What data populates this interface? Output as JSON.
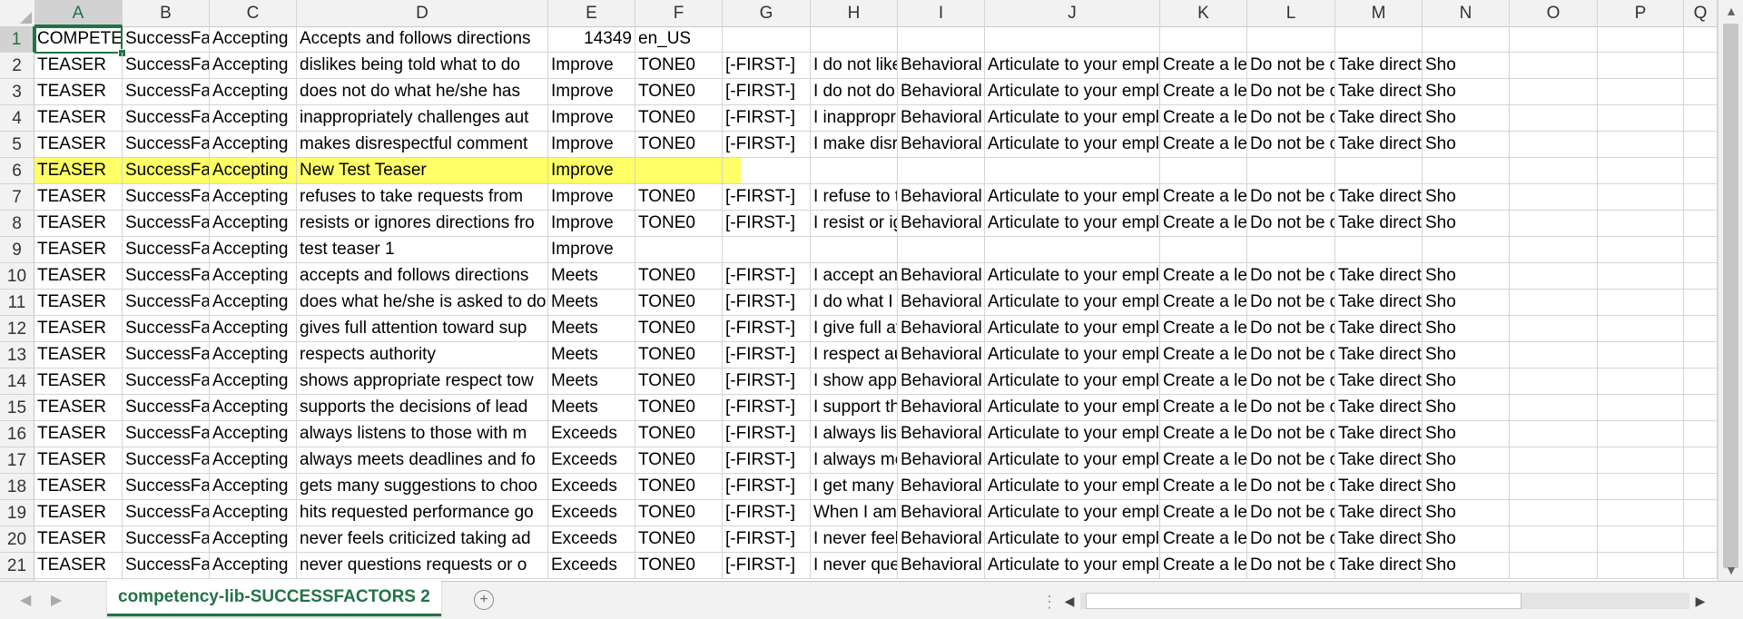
{
  "columns": [
    "A",
    "B",
    "C",
    "D",
    "E",
    "F",
    "G",
    "H",
    "I",
    "J",
    "K",
    "L",
    "M",
    "N",
    "O",
    "P",
    "Q"
  ],
  "selected_column": "A",
  "rows": [
    {
      "num": "1",
      "cells": [
        "COMPETENCY",
        "SuccessFactors",
        "Accepting",
        "Accepts and follows directions",
        "14349",
        "en_US",
        "",
        "",
        "",
        "",
        "",
        "",
        "",
        "",
        "",
        "",
        ""
      ]
    },
    {
      "num": "2",
      "cells": [
        "TEASER",
        "SuccessFactors",
        "Accepting",
        "dislikes being told what to do",
        "Improve",
        "TONE0",
        "[-FIRST-]",
        "I do not like",
        "Behavioral",
        "Articulate to your employee",
        "Create a level of mutual",
        "Do not be offended",
        "Take directions as opportunities",
        "Sho",
        "",
        "",
        ""
      ]
    },
    {
      "num": "3",
      "cells": [
        "TEASER",
        "SuccessFactors",
        "Accepting",
        "does not do what he/she has",
        "Improve",
        "TONE0",
        "[-FIRST-]",
        "I do not do",
        "Behavioral",
        "Articulate to your employee",
        "Create a level of mutual",
        "Do not be offended",
        "Take directions as opportunities",
        "Sho",
        "",
        "",
        ""
      ]
    },
    {
      "num": "4",
      "cells": [
        "TEASER",
        "SuccessFactors",
        "Accepting",
        "inappropriately challenges aut",
        "Improve",
        "TONE0",
        "[-FIRST-]",
        "I inappropriately",
        "Behavioral",
        "Articulate to your employee",
        "Create a level of mutual",
        "Do not be offended",
        "Take directions as opportunities",
        "Sho",
        "",
        "",
        ""
      ]
    },
    {
      "num": "5",
      "cells": [
        "TEASER",
        "SuccessFactors",
        "Accepting",
        "makes disrespectful comment",
        "Improve",
        "TONE0",
        "[-FIRST-]",
        "I make disrespectful",
        "Behavioral",
        "Articulate to your employee",
        "Create a level of mutual",
        "Do not be offended",
        "Take directions as opportunities",
        "Sho",
        "",
        "",
        ""
      ]
    },
    {
      "num": "6",
      "cells": [
        "TEASER",
        "SuccessFactors",
        "Accepting",
        "New Test Teaser",
        "Improve",
        "",
        "",
        "",
        "",
        "",
        "",
        "",
        "",
        "",
        "",
        "",
        ""
      ],
      "highlight": true
    },
    {
      "num": "7",
      "cells": [
        "TEASER",
        "SuccessFactors",
        "Accepting",
        "refuses to take requests from",
        "Improve",
        "TONE0",
        "[-FIRST-]",
        "I refuse to take",
        "Behavioral",
        "Articulate to your employee",
        "Create a level of mutual",
        "Do not be offended",
        "Take directions as opportunities",
        "Sho",
        "",
        "",
        ""
      ]
    },
    {
      "num": "8",
      "cells": [
        "TEASER",
        "SuccessFactors",
        "Accepting",
        "resists or ignores directions fro",
        "Improve",
        "TONE0",
        "[-FIRST-]",
        "I resist or ignore",
        "Behavioral",
        "Articulate to your employee",
        "Create a level of mutual",
        "Do not be offended",
        "Take directions as opportunities",
        "Sho",
        "",
        "",
        ""
      ]
    },
    {
      "num": "9",
      "cells": [
        "TEASER",
        "SuccessFactors",
        "Accepting",
        "test teaser 1",
        "Improve",
        "",
        "",
        "",
        "",
        "",
        "",
        "",
        "",
        "",
        "",
        "",
        ""
      ]
    },
    {
      "num": "10",
      "cells": [
        "TEASER",
        "SuccessFactors",
        "Accepting",
        "accepts and follows directions",
        "Meets",
        "TONE0",
        "[-FIRST-]",
        "I accept and",
        "Behavioral",
        "Articulate to your employee",
        "Create a level of mutual",
        "Do not be offended",
        "Take directions as opportunities",
        "Sho",
        "",
        "",
        ""
      ]
    },
    {
      "num": "11",
      "cells": [
        "TEASER",
        "SuccessFactors",
        "Accepting",
        "does what he/she is asked to do",
        "Meets",
        "TONE0",
        "[-FIRST-]",
        "I do what I am",
        "Behavioral",
        "Articulate to your employee",
        "Create a level of mutual",
        "Do not be offended",
        "Take directions as opportunities",
        "Sho",
        "",
        "",
        ""
      ]
    },
    {
      "num": "12",
      "cells": [
        "TEASER",
        "SuccessFactors",
        "Accepting",
        "gives full attention toward sup",
        "Meets",
        "TONE0",
        "[-FIRST-]",
        "I give full attention",
        "Behavioral",
        "Articulate to your employee",
        "Create a level of mutual",
        "Do not be offended",
        "Take directions as opportunities",
        "Sho",
        "",
        "",
        ""
      ]
    },
    {
      "num": "13",
      "cells": [
        "TEASER",
        "SuccessFactors",
        "Accepting",
        "respects authority",
        "Meets",
        "TONE0",
        "[-FIRST-]",
        "I respect authority",
        "Behavioral",
        "Articulate to your employee",
        "Create a level of mutual",
        "Do not be offended",
        "Take directions as opportunities",
        "Sho",
        "",
        "",
        ""
      ]
    },
    {
      "num": "14",
      "cells": [
        "TEASER",
        "SuccessFactors",
        "Accepting",
        "shows appropriate respect tow",
        "Meets",
        "TONE0",
        "[-FIRST-]",
        "I show appropriate",
        "Behavioral",
        "Articulate to your employee",
        "Create a level of mutual",
        "Do not be offended",
        "Take directions as opportunities",
        "Sho",
        "",
        "",
        ""
      ]
    },
    {
      "num": "15",
      "cells": [
        "TEASER",
        "SuccessFactors",
        "Accepting",
        "supports the decisions of lead",
        "Meets",
        "TONE0",
        "[-FIRST-]",
        "I support the",
        "Behavioral",
        "Articulate to your employee",
        "Create a level of mutual",
        "Do not be offended",
        "Take directions as opportunities",
        "Sho",
        "",
        "",
        ""
      ]
    },
    {
      "num": "16",
      "cells": [
        "TEASER",
        "SuccessFactors",
        "Accepting",
        "always listens to those with m",
        "Exceeds",
        "TONE0",
        "[-FIRST-]",
        "I always listen",
        "Behavioral",
        "Articulate to your employee",
        "Create a level of mutual",
        "Do not be offended",
        "Take directions as opportunities",
        "Sho",
        "",
        "",
        ""
      ]
    },
    {
      "num": "17",
      "cells": [
        "TEASER",
        "SuccessFactors",
        "Accepting",
        "always meets deadlines and fo",
        "Exceeds",
        "TONE0",
        "[-FIRST-]",
        "I always meet",
        "Behavioral",
        "Articulate to your employee",
        "Create a level of mutual",
        "Do not be offended",
        "Take directions as opportunities",
        "Sho",
        "",
        "",
        ""
      ]
    },
    {
      "num": "18",
      "cells": [
        "TEASER",
        "SuccessFactors",
        "Accepting",
        "gets many suggestions to choo",
        "Exceeds",
        "TONE0",
        "[-FIRST-]",
        "I get many s",
        "Behavioral",
        "Articulate to your employee",
        "Create a level of mutual",
        "Do not be offended",
        "Take directions as opportunities",
        "Sho",
        "",
        "",
        ""
      ]
    },
    {
      "num": "19",
      "cells": [
        "TEASER",
        "SuccessFactors",
        "Accepting",
        "hits requested performance go",
        "Exceeds",
        "TONE0",
        "[-FIRST-]",
        "When I am p",
        "Behavioral",
        "Articulate to your employee",
        "Create a level of mutual",
        "Do not be offended",
        "Take directions as opportunities",
        "Sho",
        "",
        "",
        ""
      ]
    },
    {
      "num": "20",
      "cells": [
        "TEASER",
        "SuccessFactors",
        "Accepting",
        "never feels criticized taking ad",
        "Exceeds",
        "TONE0",
        "[-FIRST-]",
        "I never feel c",
        "Behavioral",
        "Articulate to your employee",
        "Create a level of mutual",
        "Do not be offended",
        "Take directions as opportunities",
        "Sho",
        "",
        "",
        ""
      ]
    },
    {
      "num": "21",
      "cells": [
        "TEASER",
        "SuccessFactors",
        "Accepting",
        "never questions requests or o",
        "Exceeds",
        "TONE0",
        "[-FIRST-]",
        "I never ques",
        "Behavioral",
        "Articulate to your employee",
        "Create a level of mutual",
        "Do not be offended",
        "Take directions as opportunities",
        "Sho",
        "",
        "",
        ""
      ]
    }
  ],
  "sheet_tab": "competency-lib-SUCCESSFACTORS 2",
  "icons": {
    "tab_prev": "◀",
    "tab_next": "▶",
    "add_sheet": "+",
    "splitter": "⋮",
    "scroll_left": "◀",
    "scroll_right": "▶",
    "scroll_up": "▲",
    "scroll_down": "▼"
  },
  "colors": {
    "accent": "#217346",
    "highlight": "#ffff66"
  }
}
